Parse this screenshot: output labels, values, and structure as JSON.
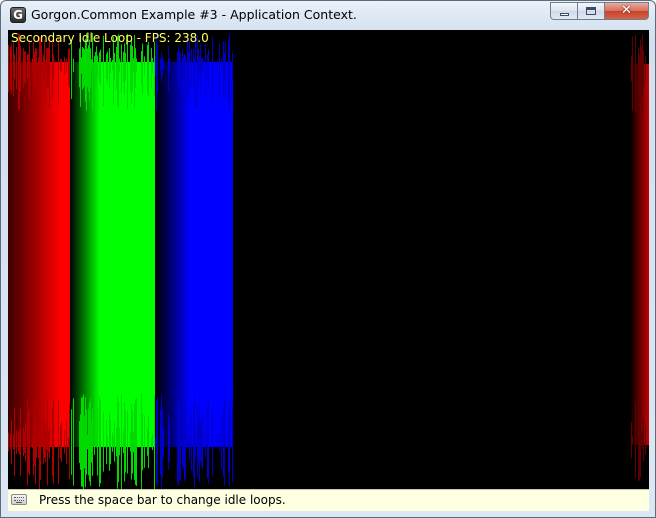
{
  "window": {
    "title": "Gorgon.Common Example #3 - Application Context.",
    "icon": "gorgon-app-icon",
    "buttons": {
      "minimize": "minimize-icon",
      "maximize": "maximize-icon",
      "close": "close-icon"
    }
  },
  "render": {
    "fps_label": "Secondary Idle Loop - FPS: 238.0",
    "fps_color": "#ffff60",
    "background": "#000000",
    "bands": [
      {
        "name": "red",
        "color": "#ff0000"
      },
      {
        "name": "green",
        "color": "#00ff00"
      },
      {
        "name": "blue",
        "color": "#0000ff"
      },
      {
        "name": "red-fade",
        "color": "#ff0000"
      }
    ]
  },
  "status": {
    "icon": "keyboard-icon",
    "text": "Press the space bar to change idle loops.",
    "background": "#ffffe1"
  }
}
